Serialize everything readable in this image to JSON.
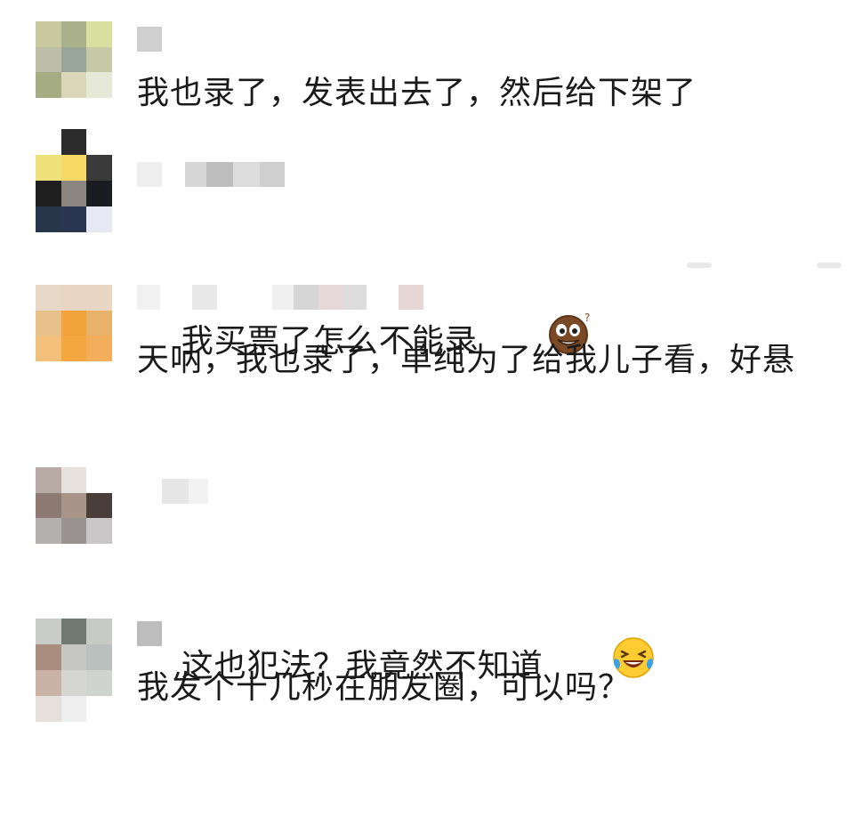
{
  "comments": [
    {
      "text": "我也录了，发表出去了，然后给下架了",
      "emoji": ""
    },
    {
      "text": "我买票了怎么不能录",
      "emoji": "cookie-face-emoji"
    },
    {
      "text": "天呐，我也录了，单纯为了给我儿子看，好悬",
      "emoji": ""
    },
    {
      "text": "这也犯法？我竟然不知道",
      "emoji": "laughing-tears-emoji"
    },
    {
      "text": "我发个十几秒在朋友圈，可以吗？",
      "emoji": ""
    }
  ],
  "colors": {
    "text": "#1a1a1a",
    "background": "#ffffff",
    "mosaic_light": "#d9d9d9"
  }
}
